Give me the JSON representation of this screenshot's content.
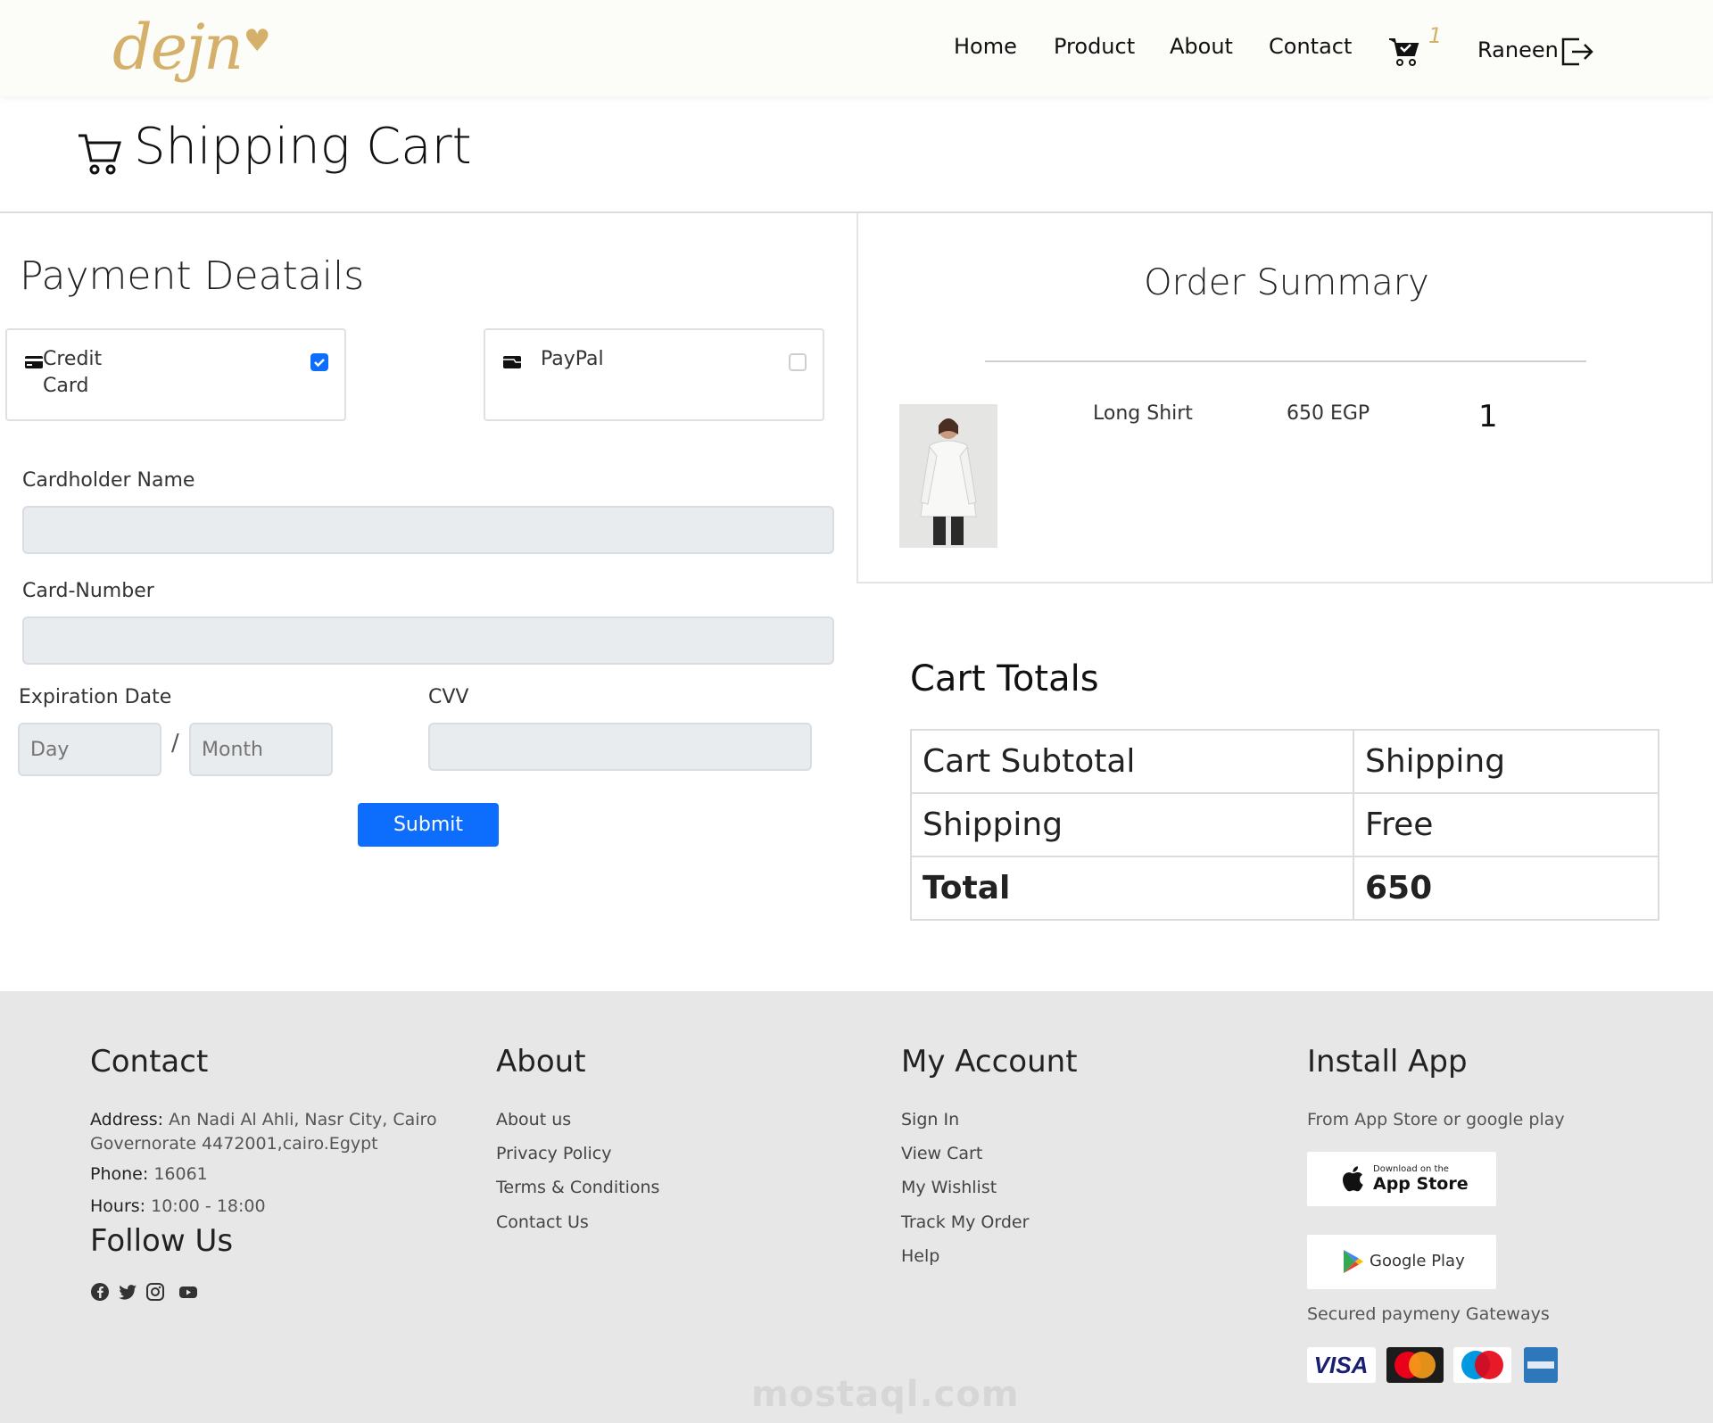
{
  "brand": {
    "logo_text": "dejn",
    "gold": "#d4b06a",
    "accent_blue": "#0d6efd"
  },
  "header": {
    "nav": [
      "Home",
      "Product",
      "About",
      "Contact"
    ],
    "cart_count": "1",
    "user_name": "Raneen"
  },
  "page_title": "Shipping Cart",
  "payment": {
    "title": "Payment Deatails",
    "methods": [
      {
        "label_line1": "Credit",
        "label_line2": "Card",
        "icon": "credit-card-icon",
        "checked": true
      },
      {
        "label_line1": "PayPal",
        "icon": "wallet-icon",
        "checked": false
      }
    ],
    "cardholder_label": "Cardholder Name",
    "cardholder_value": "",
    "card_number_label": "Card-Number",
    "card_number_value": "",
    "expiration_label": "Expiration Date",
    "day_placeholder": "Day",
    "month_placeholder": "Month",
    "separator": "/",
    "cvv_label": "CVV",
    "submit_label": "Submit"
  },
  "order_summary": {
    "title": "Order Summary",
    "items": [
      {
        "name": "Long Shirt",
        "price": "650 EGP",
        "qty": "1"
      }
    ]
  },
  "cart_totals": {
    "title": "Cart Totals",
    "rows": [
      {
        "label": "Cart Subtotal",
        "value": "Shipping"
      },
      {
        "label": "Shipping",
        "value": "Free"
      },
      {
        "label": "Total",
        "value": "650"
      }
    ]
  },
  "footer": {
    "contact": {
      "heading": "Contact",
      "address_label": "Address:",
      "address_line1": "An Nadi Al Ahli, Nasr City, Cairo",
      "address_line2": "Governorate 4472001,cairo.Egypt",
      "phone_label": "Phone:",
      "phone": "16061",
      "hours_label": "Hours:",
      "hours": "10:00 - 18:00",
      "follow_heading": "Follow Us"
    },
    "about": {
      "heading": "About",
      "links": [
        "About us",
        "Privacy Policy",
        "Terms & Conditions",
        "Contact Us"
      ]
    },
    "account": {
      "heading": "My Account",
      "links": [
        "Sign In",
        "View Cart",
        "My Wishlist",
        "Track My Order",
        "Help"
      ]
    },
    "install": {
      "heading": "Install App",
      "subtitle": "From App Store or google play",
      "appstore_small": "Download on the",
      "appstore_big": "App Store",
      "googleplay": "Google Play",
      "gateways_label": "Secured paymeny Gateways"
    },
    "watermark": "mostaql.com"
  }
}
